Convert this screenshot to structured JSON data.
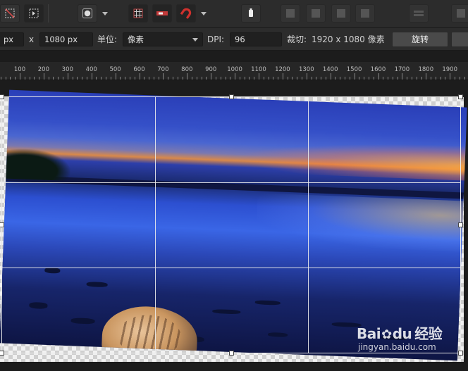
{
  "toolbar": {
    "buttons": [
      {
        "name": "crop-toggle-icon"
      },
      {
        "name": "crop-mode-icon"
      },
      {
        "name": "circle-select-icon"
      },
      {
        "name": "grid-overlay-icon"
      },
      {
        "name": "snapping-icon"
      },
      {
        "name": "magnet-icon"
      },
      {
        "name": "trash-icon"
      }
    ]
  },
  "context": {
    "width_value": "px",
    "x_label": "x",
    "height_value": "1080 px",
    "unit_label": "单位:",
    "unit_value": "像素",
    "dpi_label": "DPI:",
    "dpi_value": "96",
    "crop_label": "裁切:",
    "crop_value": "1920 x 1080 像素",
    "rotate_label": "旋转"
  },
  "ruler": {
    "labels": [
      "100",
      "200",
      "300",
      "400",
      "500",
      "600",
      "700",
      "800",
      "900",
      "1000",
      "1100",
      "1200",
      "1300",
      "1400",
      "1500",
      "1600",
      "1700",
      "1800",
      "1900"
    ]
  },
  "watermark": {
    "logo_left": "Bai",
    "logo_paw": "✿",
    "logo_mid": "du",
    "logo_right": "经验",
    "url": "jingyan.baidu.com"
  },
  "colors": {
    "accent_magnet": "#d0312d",
    "crop_frame": "#e8e8e8"
  }
}
